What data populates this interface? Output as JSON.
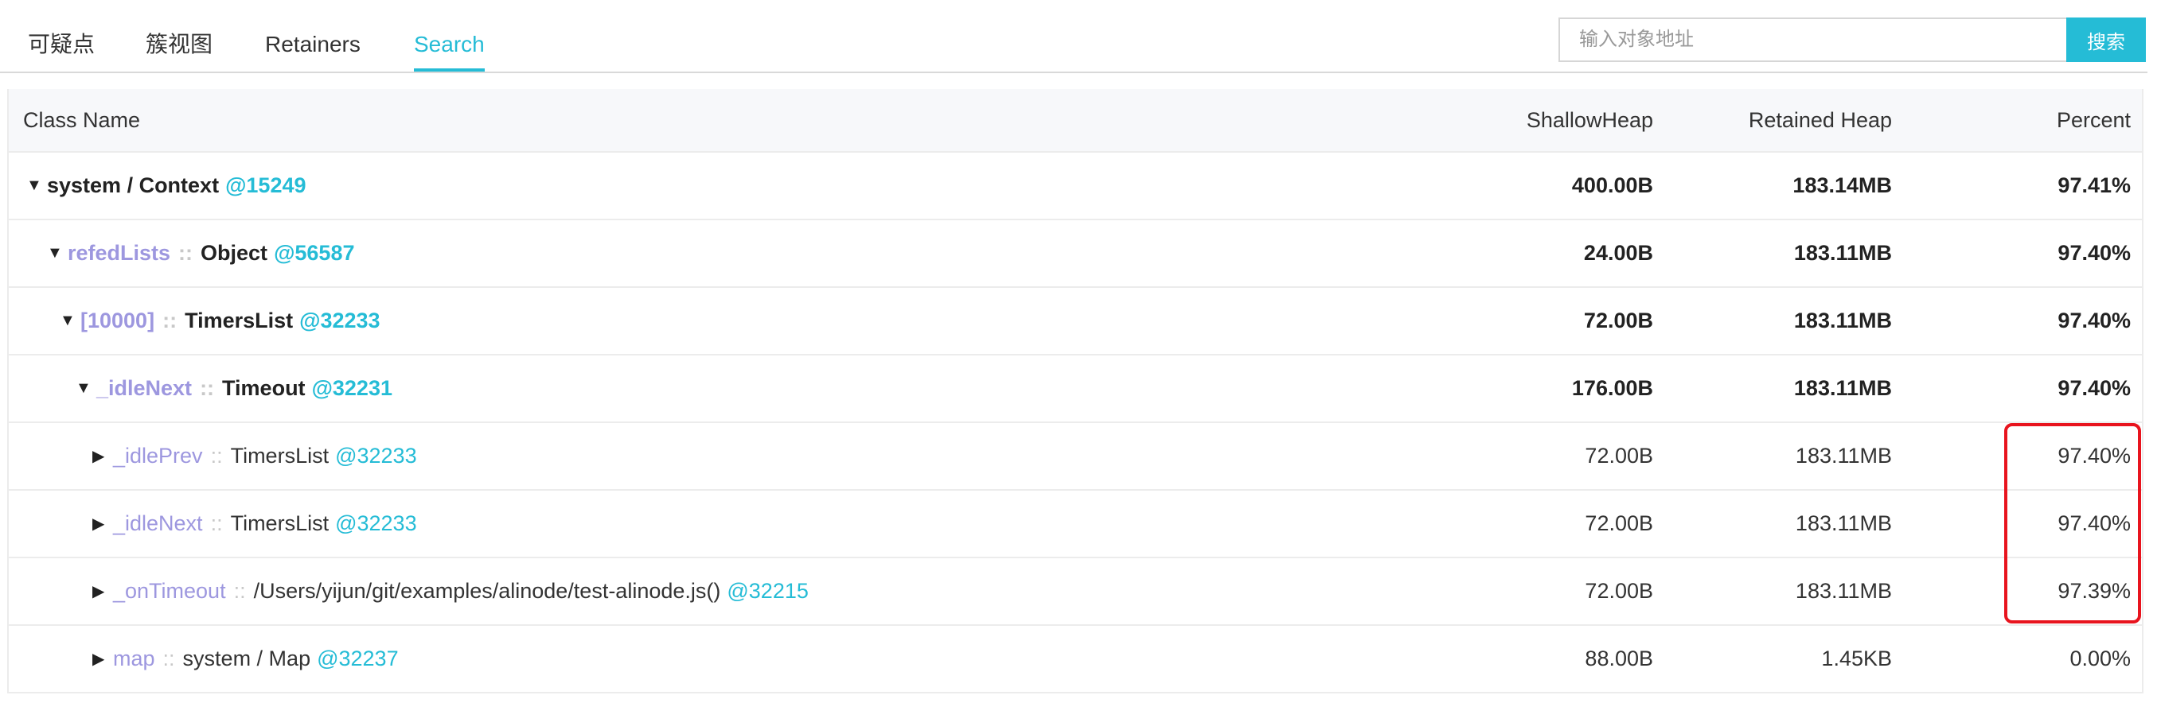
{
  "tabs": [
    {
      "label": "可疑点",
      "active": false
    },
    {
      "label": "簇视图",
      "active": false
    },
    {
      "label": "Retainers",
      "active": false
    },
    {
      "label": "Search",
      "active": true
    }
  ],
  "search": {
    "placeholder": "输入对象地址",
    "value": "",
    "button_label": "搜索"
  },
  "accent_color": "#25bcd6",
  "table": {
    "headers": {
      "class_name": "Class Name",
      "shallow_heap": "ShallowHeap",
      "retained_heap": "Retained Heap",
      "percent": "Percent"
    },
    "rows": [
      {
        "expanded": true,
        "field": "",
        "type": "system / Context",
        "addr": "@15249",
        "shallow": "400.00B",
        "retained": "183.14MB",
        "percent": "97.41%"
      },
      {
        "expanded": true,
        "field": "refedLists",
        "sep": "::",
        "type": "Object",
        "addr": "@56587",
        "shallow": "24.00B",
        "retained": "183.11MB",
        "percent": "97.40%"
      },
      {
        "expanded": true,
        "field": "[10000]",
        "sep": "::",
        "type": "TimersList",
        "addr": "@32233",
        "shallow": "72.00B",
        "retained": "183.11MB",
        "percent": "97.40%"
      },
      {
        "expanded": true,
        "field": "_idleNext",
        "sep": "::",
        "type": "Timeout",
        "addr": "@32231",
        "shallow": "176.00B",
        "retained": "183.11MB",
        "percent": "97.40%"
      },
      {
        "expanded": false,
        "field": "_idlePrev",
        "sep": "::",
        "type": "TimersList",
        "addr": "@32233",
        "shallow": "72.00B",
        "retained": "183.11MB",
        "percent": "97.40%"
      },
      {
        "expanded": false,
        "field": "_idleNext",
        "sep": "::",
        "type": "TimersList",
        "addr": "@32233",
        "shallow": "72.00B",
        "retained": "183.11MB",
        "percent": "97.40%"
      },
      {
        "expanded": false,
        "field": "_onTimeout",
        "sep": "::",
        "type": "/Users/yijun/git/examples/alinode/test-alinode.js()",
        "addr": "@32215",
        "shallow": "72.00B",
        "retained": "183.11MB",
        "percent": "97.39%"
      },
      {
        "expanded": false,
        "field": "map",
        "sep": "::",
        "type": "system / Map",
        "addr": "@32237",
        "shallow": "88.00B",
        "retained": "1.45KB",
        "percent": "0.00%"
      }
    ]
  }
}
